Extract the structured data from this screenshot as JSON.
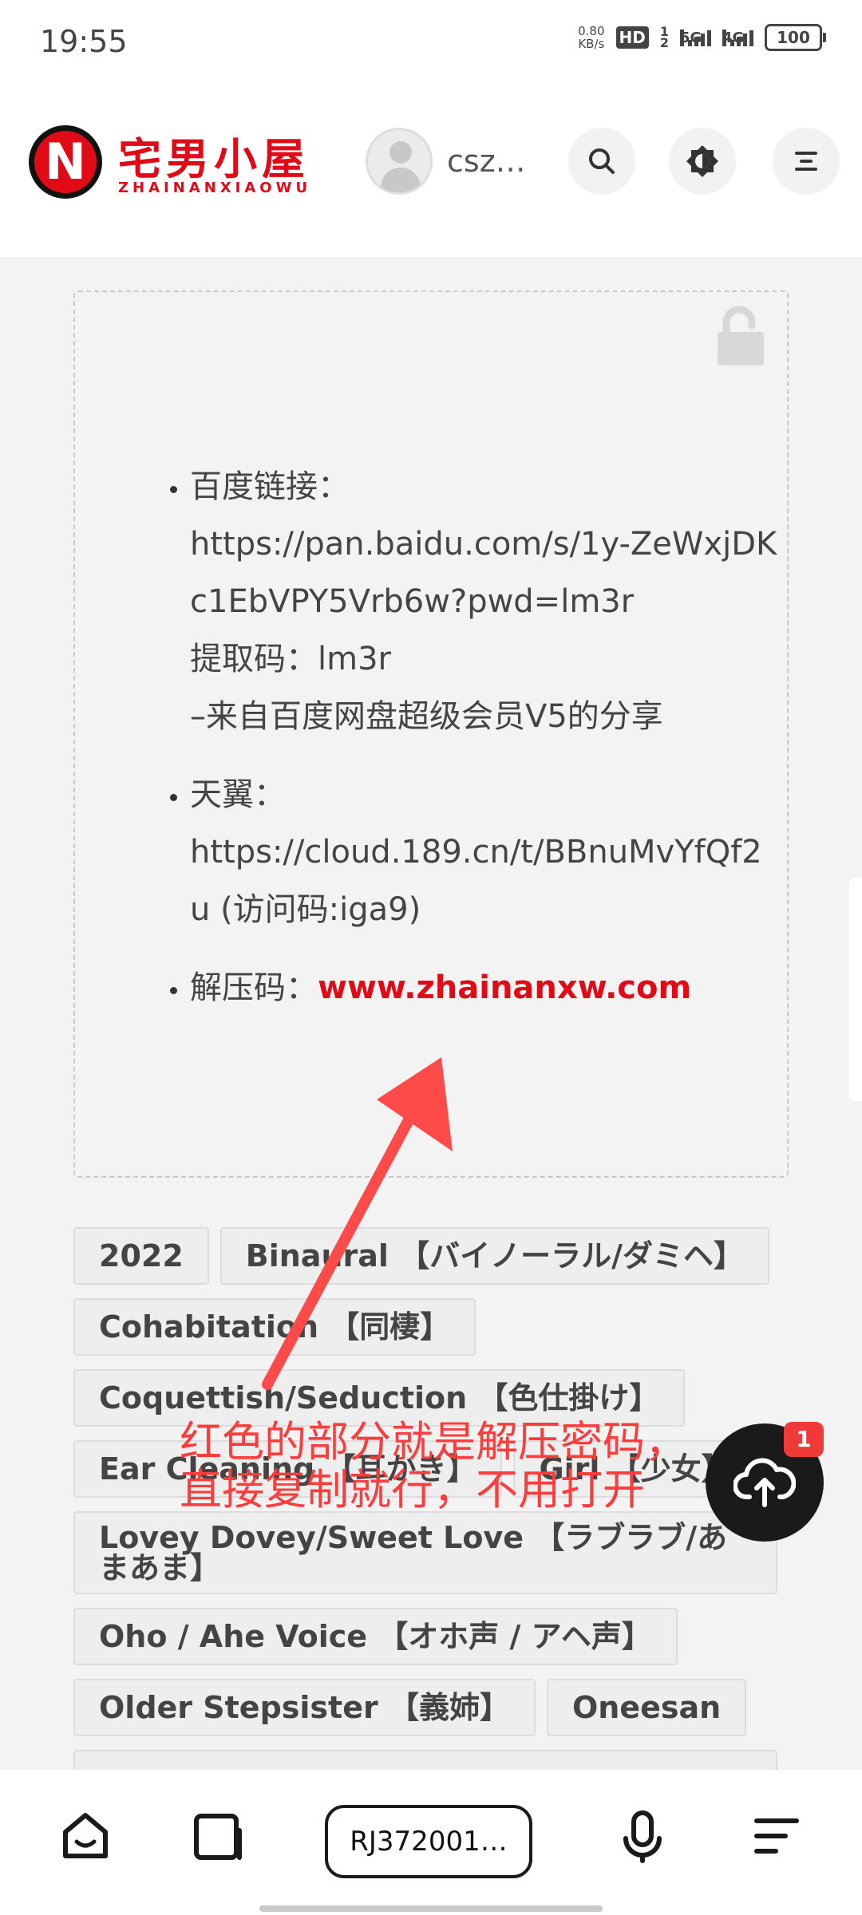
{
  "status": {
    "time": "19:55",
    "net_speed_value": "0.80",
    "net_speed_unit": "KB/s",
    "hd": "HD",
    "sim1": "1",
    "sim2": "2",
    "signal1": "5G",
    "signal2": "4G",
    "battery": "100"
  },
  "header": {
    "logo_letter": "N",
    "logo_title": "宅男小屋",
    "logo_subtitle": "ZHAINANXIAOWU",
    "username": "csz…"
  },
  "links": [
    {
      "label": "百度链接：",
      "lines": [
        "https://pan.baidu.com/s/1y-ZeWxjDKc1EbVPY5Vrb6w?pwd=lm3r",
        "提取码：lm3r",
        "–来自百度网盘超级会员V5的分享"
      ]
    },
    {
      "label": "天翼：",
      "lines": [
        "https://cloud.189.cn/t/BBnuMvYfQf2u (访问码:iga9)"
      ]
    }
  ],
  "unzip": {
    "label": "解压码：",
    "value": "www.zhainanxw.com"
  },
  "tags": [
    "2022",
    "Binaural 【バイノーラル/ダミヘ】",
    "Cohabitation 【同棲】",
    "Coquettish/Seduction 【色仕掛け】",
    "Ear Cleaning 【耳かき】",
    "Girl 【少女】",
    "Lovey Dovey/Sweet Love 【ラブラブ/あまあま】",
    "Oho / Ahe Voice 【オホ声 / アヘ声】",
    "Older Stepsister 【義姉】",
    "Oneesan"
  ],
  "annotation": {
    "line1": "红色的部分就是解压密码，",
    "line2": "直接复制就行，不用打开"
  },
  "fab": {
    "badge": "1"
  },
  "bottom": {
    "search_text": "RJ372001…"
  },
  "colors": {
    "accent": "#e10a17",
    "annotation": "#ff3b3b",
    "fab": "#1a1a1a"
  }
}
